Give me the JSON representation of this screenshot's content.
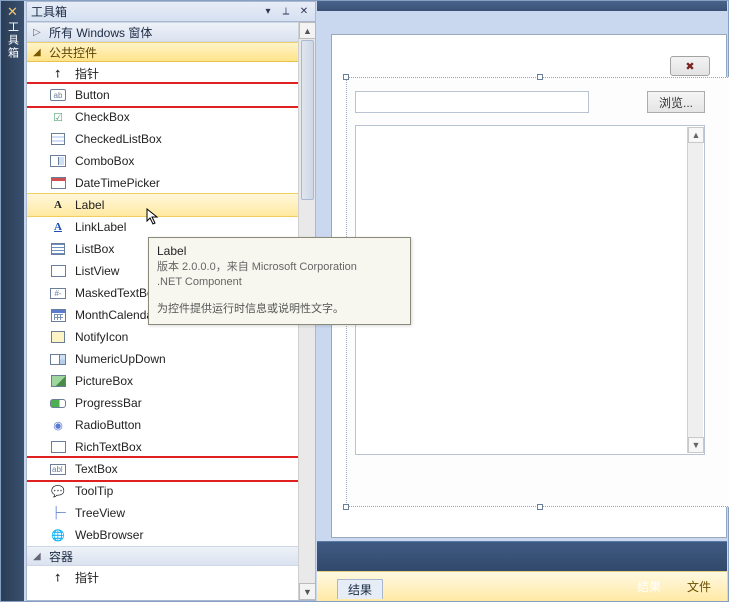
{
  "leftTab": {
    "label": "工具箱"
  },
  "toolbox": {
    "title": "工具箱",
    "groups": {
      "allForms": {
        "label": "所有 Windows 窗体",
        "expanded": false
      },
      "common": {
        "label": "公共控件",
        "expanded": true
      },
      "containers": {
        "label": "容器",
        "expanded": true
      }
    },
    "commonItems": [
      {
        "id": "pointer",
        "label": "指针"
      },
      {
        "id": "button",
        "label": "Button"
      },
      {
        "id": "checkbox",
        "label": "CheckBox"
      },
      {
        "id": "checkedlistbox",
        "label": "CheckedListBox"
      },
      {
        "id": "combobox",
        "label": "ComboBox"
      },
      {
        "id": "datetimepicker",
        "label": "DateTimePicker"
      },
      {
        "id": "label",
        "label": "Label"
      },
      {
        "id": "linklabel",
        "label": "LinkLabel"
      },
      {
        "id": "listbox",
        "label": "ListBox"
      },
      {
        "id": "listview",
        "label": "ListView"
      },
      {
        "id": "maskedtextbox",
        "label": "MaskedTextBox"
      },
      {
        "id": "monthcalendar",
        "label": "MonthCalendar"
      },
      {
        "id": "notifyicon",
        "label": "NotifyIcon"
      },
      {
        "id": "numericupdown",
        "label": "NumericUpDown"
      },
      {
        "id": "picturebox",
        "label": "PictureBox"
      },
      {
        "id": "progressbar",
        "label": "ProgressBar"
      },
      {
        "id": "radiobutton",
        "label": "RadioButton"
      },
      {
        "id": "richtextbox",
        "label": "RichTextBox"
      },
      {
        "id": "textbox",
        "label": "TextBox"
      },
      {
        "id": "tooltip",
        "label": "ToolTip"
      },
      {
        "id": "treeview",
        "label": "TreeView"
      },
      {
        "id": "webbrowser",
        "label": "WebBrowser"
      }
    ],
    "containerItems": [
      {
        "id": "pointer2",
        "label": "指针"
      }
    ]
  },
  "tooltip": {
    "title": "Label",
    "line1": "版本 2.0.0.0，来自 Microsoft Corporation",
    "line2": ".NET Component",
    "desc": "为控件提供运行时信息或说明性文字。"
  },
  "form": {
    "browseLabel": "浏览..."
  },
  "bottom": {
    "resultsTab": "结果",
    "filesTab": "文件"
  }
}
